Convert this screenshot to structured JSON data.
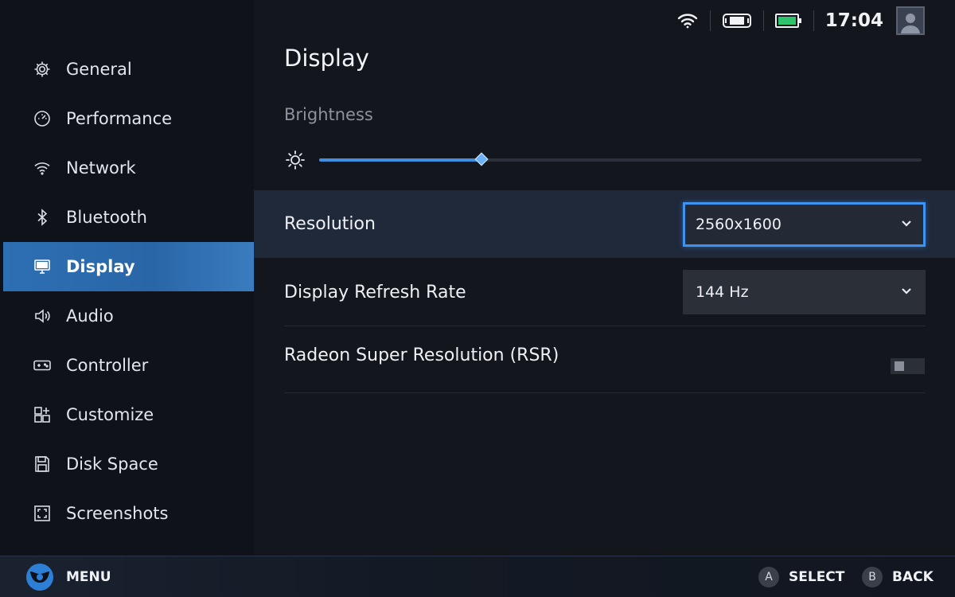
{
  "status_bar": {
    "time": "17:04",
    "icons": [
      "wifi-icon",
      "device-icon",
      "battery-icon",
      "avatar"
    ],
    "battery_color": "#2fc46b"
  },
  "sidebar": {
    "items": [
      {
        "label": "General",
        "icon": "gear-icon",
        "active": false
      },
      {
        "label": "Performance",
        "icon": "gauge-icon",
        "active": false
      },
      {
        "label": "Network",
        "icon": "wifi-icon",
        "active": false
      },
      {
        "label": "Bluetooth",
        "icon": "bluetooth-icon",
        "active": false
      },
      {
        "label": "Display",
        "icon": "monitor-icon",
        "active": true
      },
      {
        "label": "Audio",
        "icon": "speaker-icon",
        "active": false
      },
      {
        "label": "Controller",
        "icon": "gamepad-icon",
        "active": false
      },
      {
        "label": "Customize",
        "icon": "customize-icon",
        "active": false
      },
      {
        "label": "Disk Space",
        "icon": "disk-icon",
        "active": false
      },
      {
        "label": "Screenshots",
        "icon": "screenshot-icon",
        "active": false
      }
    ],
    "accent": "#2d6fb3"
  },
  "main": {
    "title": "Display",
    "brightness": {
      "label": "Brightness",
      "value": 0.27
    },
    "settings": [
      {
        "label": "Resolution",
        "value": "2560x1600",
        "control": "dropdown",
        "focused": true
      },
      {
        "label": "Display Refresh Rate",
        "value": "144 Hz",
        "control": "dropdown",
        "focused": false
      },
      {
        "label": "Radeon Super Resolution (RSR)",
        "control": "toggle",
        "on": false
      }
    ],
    "accent": "#3e92f0"
  },
  "bottom_bar": {
    "menu_label": "MENU",
    "hints": [
      {
        "button": "A",
        "label": "SELECT"
      },
      {
        "button": "B",
        "label": "BACK"
      }
    ]
  }
}
